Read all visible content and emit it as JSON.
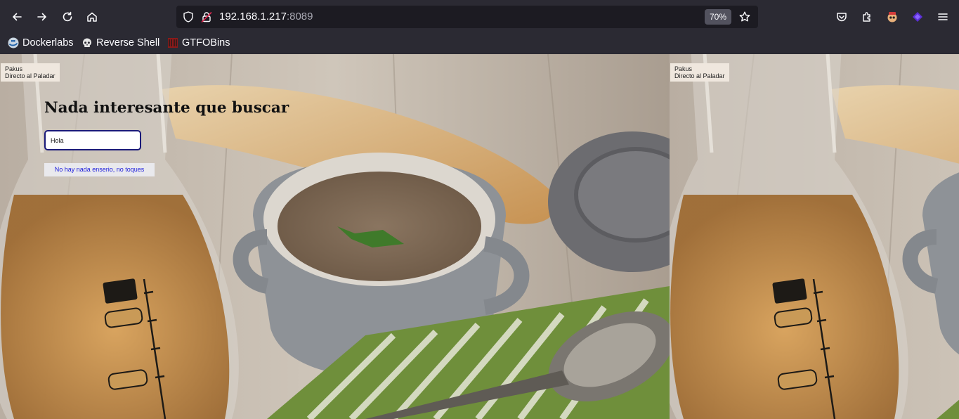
{
  "browser": {
    "url_host": "192.168.1.217",
    "url_port": ":8089",
    "zoom_level": "70%",
    "icons": [
      "back-icon",
      "forward-icon",
      "reload-icon",
      "home-icon",
      "shield-icon",
      "lock-icon",
      "star-icon",
      "pocket-icon",
      "extensions-icon",
      "extension-avatar-icon",
      "extension-purple-icon",
      "menu-icon"
    ]
  },
  "bookmarks": [
    {
      "label": "Dockerlabs",
      "icon": "dockerlabs-icon"
    },
    {
      "label": "Reverse Shell",
      "icon": "skull-icon"
    },
    {
      "label": "GTFOBins",
      "icon": "gtfobins-icon"
    }
  ],
  "page": {
    "label_line1": "Pakus",
    "label_line2": "Directo al Paladar",
    "title": "Nada interesante que buscar",
    "search_value": "Hola",
    "button_label": "No hay nada enserio, no toques"
  },
  "colors": {
    "chrome_bg": "#2b2a33",
    "urlbar_bg": "#1c1b22",
    "input_border": "#1a1a7a",
    "button_text": "#1a1adb"
  }
}
